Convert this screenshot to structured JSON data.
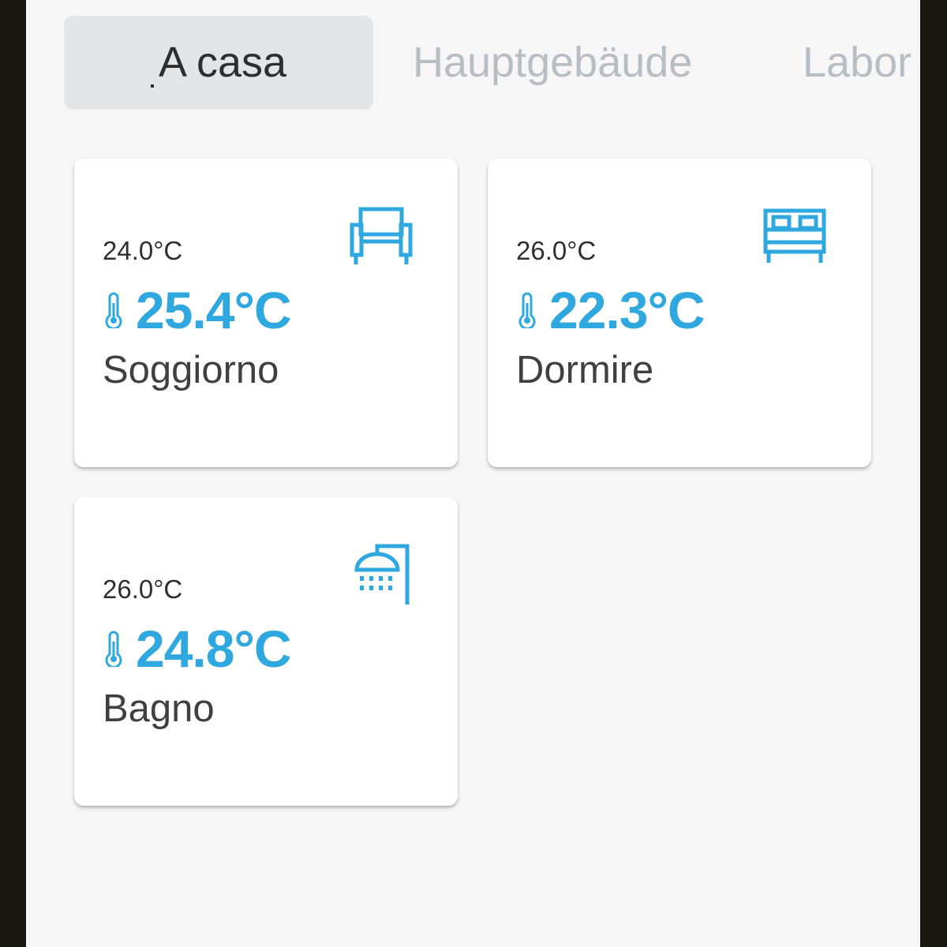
{
  "tabs": [
    {
      "label": "A casa",
      "active": true
    },
    {
      "label": "Hauptgebäude",
      "active": false
    },
    {
      "label": "Labor",
      "active": false
    }
  ],
  "rooms": [
    {
      "name": "Soggiorno",
      "setpoint": "24.0°C",
      "current": "25.4°C",
      "icon": "armchair-icon"
    },
    {
      "name": "Dormire",
      "setpoint": "26.0°C",
      "current": "22.3°C",
      "icon": "bed-icon"
    },
    {
      "name": "Bagno",
      "setpoint": "26.0°C",
      "current": "24.8°C",
      "icon": "shower-icon"
    }
  ],
  "colors": {
    "accent": "#2ea8de",
    "background": "#f6f6f6",
    "card": "#ffffff",
    "active_tab_bg": "#e3e4e6",
    "inactive_tab_text": "#b8bdc3"
  }
}
